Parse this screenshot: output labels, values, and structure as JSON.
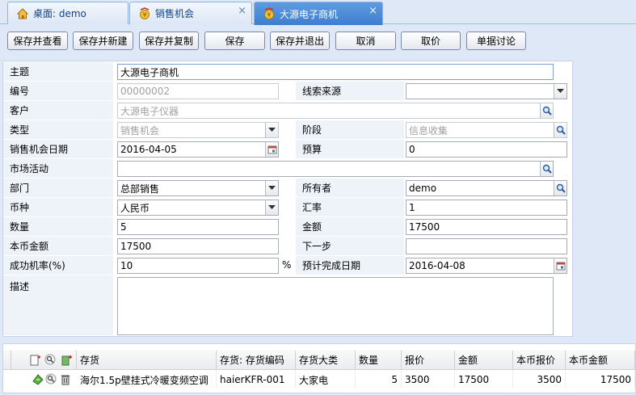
{
  "tabs": [
    {
      "label": "桌面: demo"
    },
    {
      "label": "销售机会",
      "close": "×"
    },
    {
      "label": "大源电子商机",
      "close": "×"
    }
  ],
  "toolbar": {
    "save_view": "保存并查看",
    "save_new": "保存并新建",
    "save_copy": "保存并复制",
    "save": "保存",
    "save_exit": "保存并退出",
    "cancel": "取消",
    "quote": "取价",
    "discuss": "单据讨论"
  },
  "form": {
    "subject": {
      "label": "主题",
      "value": "大源电子商机"
    },
    "code": {
      "label": "编号",
      "value": "00000002"
    },
    "lead_source": {
      "label": "线索来源",
      "value": ""
    },
    "customer": {
      "label": "客户",
      "value": "大源电子仪器"
    },
    "type": {
      "label": "类型",
      "value": "销售机会"
    },
    "stage": {
      "label": "阶段",
      "value": "信息收集"
    },
    "opp_date": {
      "label": "销售机会日期",
      "value": "2016-04-05"
    },
    "budget": {
      "label": "预算",
      "value": "0"
    },
    "campaign": {
      "label": "市场活动",
      "value": ""
    },
    "department": {
      "label": "部门",
      "value": "总部销售"
    },
    "owner": {
      "label": "所有者",
      "value": "demo"
    },
    "currency": {
      "label": "币种",
      "value": "人民币"
    },
    "rate": {
      "label": "汇率",
      "value": "1"
    },
    "quantity": {
      "label": "数量",
      "value": "5"
    },
    "amount": {
      "label": "金额",
      "value": "17500"
    },
    "local_amount": {
      "label": "本币金额",
      "value": "17500"
    },
    "next_step": {
      "label": "下一步",
      "value": ""
    },
    "probability": {
      "label": "成功机率(%)",
      "value": "10",
      "unit": "%"
    },
    "expected_date": {
      "label": "预计完成日期",
      "value": "2016-04-08"
    },
    "description": {
      "label": "描述",
      "value": ""
    }
  },
  "grid": {
    "headers": [
      "存货",
      "存货: 存货编码",
      "存货大类",
      "数量",
      "报价",
      "金额",
      "本币报价",
      "本币金额"
    ],
    "rows": [
      [
        "海尔1.5p壁挂式冷暖变频空调",
        "haierKFR-001",
        "大家电",
        "5",
        "3500",
        "17500",
        "3500",
        "17500"
      ]
    ]
  },
  "colors": {
    "accent": "#3d7ed0",
    "label_bg": "#eef3fa",
    "page_bg": "#dfe8f6"
  },
  "icons": [
    "home-icon",
    "opportunity-icon",
    "close-icon",
    "dropdown-icon",
    "search-icon",
    "calendar-icon",
    "add-row-icon",
    "delete-row-icon"
  ]
}
